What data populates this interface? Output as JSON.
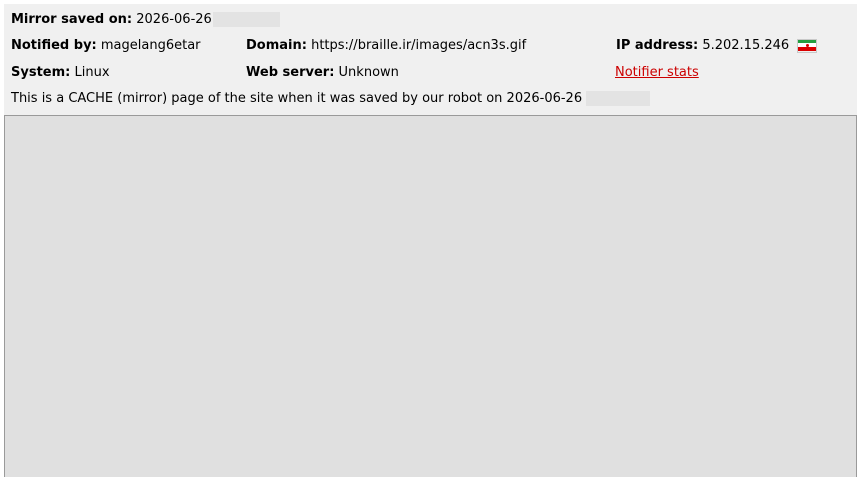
{
  "colors": {
    "header_bg": "#f0f0f0",
    "frame_bg": "#e0e0e0",
    "link": "#cc0000",
    "flag_green": "#239f40",
    "flag_white": "#ffffff",
    "flag_red": "#da0000"
  },
  "mirror": {
    "saved_label": "Mirror saved on:",
    "saved_date": "2026-06-26"
  },
  "notified": {
    "label": "Notified by:",
    "value": "magelang6etar"
  },
  "domain": {
    "label": "Domain:",
    "value": "https://braille.ir/images/acn3s.gif"
  },
  "ip": {
    "label": "IP address:",
    "value": "5.202.15.246",
    "flag_icon": "iran-flag-icon"
  },
  "system": {
    "label": "System:",
    "value": "Linux"
  },
  "webserver": {
    "label": "Web server:",
    "value": "Unknown"
  },
  "notifier_stats": {
    "label": "Notifier stats"
  },
  "cache_notice": {
    "text": "This is a CACHE (mirror) page of the site when it was saved by our robot on 2026-06-26"
  }
}
